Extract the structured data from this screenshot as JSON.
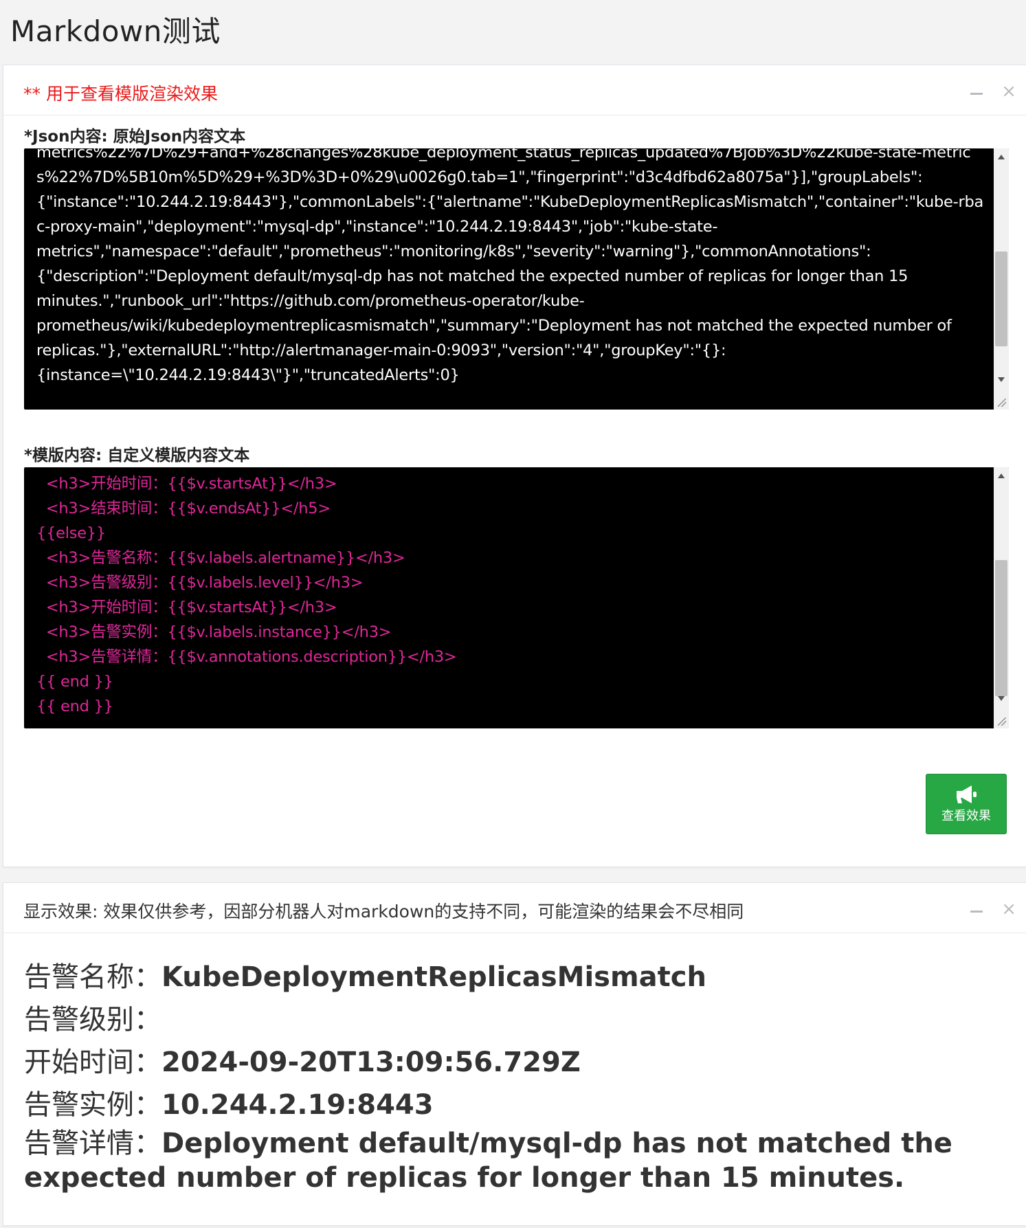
{
  "page": {
    "title": "Markdown测试"
  },
  "editor_panel": {
    "title": "** 用于查看模版渲染效果",
    "minimize_icon": "minus-icon",
    "close_icon": "close-icon",
    "close_glyph": "×",
    "json_label": "*Json内容: 原始Json内容文本",
    "json_text": "metrics%22%7D%29+and+%28changes%28kube_deployment_status_replicas_updated%7Bjob%3D%22kube-state-metrics%22%7D%5B10m%5D%29+%3D%3D+0%29\\u0026g0.tab=1\",\"fingerprint\":\"d3c4dfbd62a8075a\"}],\"groupLabels\":\n{\"instance\":\"10.244.2.19:8443\"},\"commonLabels\":{\"alertname\":\"KubeDeploymentReplicasMismatch\",\"container\":\"kube-rbac-proxy-main\",\"deployment\":\"mysql-dp\",\"instance\":\"10.244.2.19:8443\",\"job\":\"kube-state-\nmetrics\",\"namespace\":\"default\",\"prometheus\":\"monitoring/k8s\",\"severity\":\"warning\"},\"commonAnnotations\":\n{\"description\":\"Deployment default/mysql-dp has not matched the expected number of replicas for longer than 15\nminutes.\",\"runbook_url\":\"https://github.com/prometheus-operator/kube-\nprometheus/wiki/kubedeploymentreplicasmismatch\",\"summary\":\"Deployment has not matched the expected number of\nreplicas.\"},\"externalURL\":\"http://alertmanager-main-0:9093\",\"version\":\"4\",\"groupKey\":\"{}:\n{instance=\\\"10.244.2.19:8443\\\"}\",\"truncatedAlerts\":0}",
    "template_label": "*模版内容: 自定义模版内容文本",
    "template_text": "  <h3>开始时间：{{$v.startsAt}}</h3>\n  <h3>结束时间：{{$v.endsAt}}</h5>\n{{else}}\n  <h3>告警名称：{{$v.labels.alertname}}</h3>\n  <h3>告警级别：{{$v.labels.level}}</h3>\n  <h3>开始时间：{{$v.startsAt}}</h3>\n  <h3>告警实例：{{$v.labels.instance}}</h3>\n  <h3>告警详情：{{$v.annotations.description}}</h3>\n{{ end }}\n{{ end }}",
    "view_button": {
      "icon": "megaphone-icon",
      "label": "查看效果"
    }
  },
  "preview_panel": {
    "title": "显示效果: 效果仅供参考，因部分机器人对markdown的支持不同，可能渲染的结果会不尽相同",
    "minimize_icon": "minus-icon",
    "close_icon": "close-icon",
    "close_glyph": "×",
    "rows": [
      {
        "key": "告警名称：",
        "value": "KubeDeploymentReplicasMismatch"
      },
      {
        "key": "告警级别：",
        "value": ""
      },
      {
        "key": "开始时间：",
        "value": "2024-09-20T13:09:56.729Z"
      },
      {
        "key": "告警实例：",
        "value": "10.244.2.19:8443"
      },
      {
        "key": "告警详情：",
        "value": "Deployment default/mysql-dp has not matched the expected number of replicas for longer than 15 minutes."
      }
    ]
  },
  "colors": {
    "accent_red": "#ea1a1a",
    "template_pink": "#e0279a",
    "button_green": "#28a745"
  }
}
